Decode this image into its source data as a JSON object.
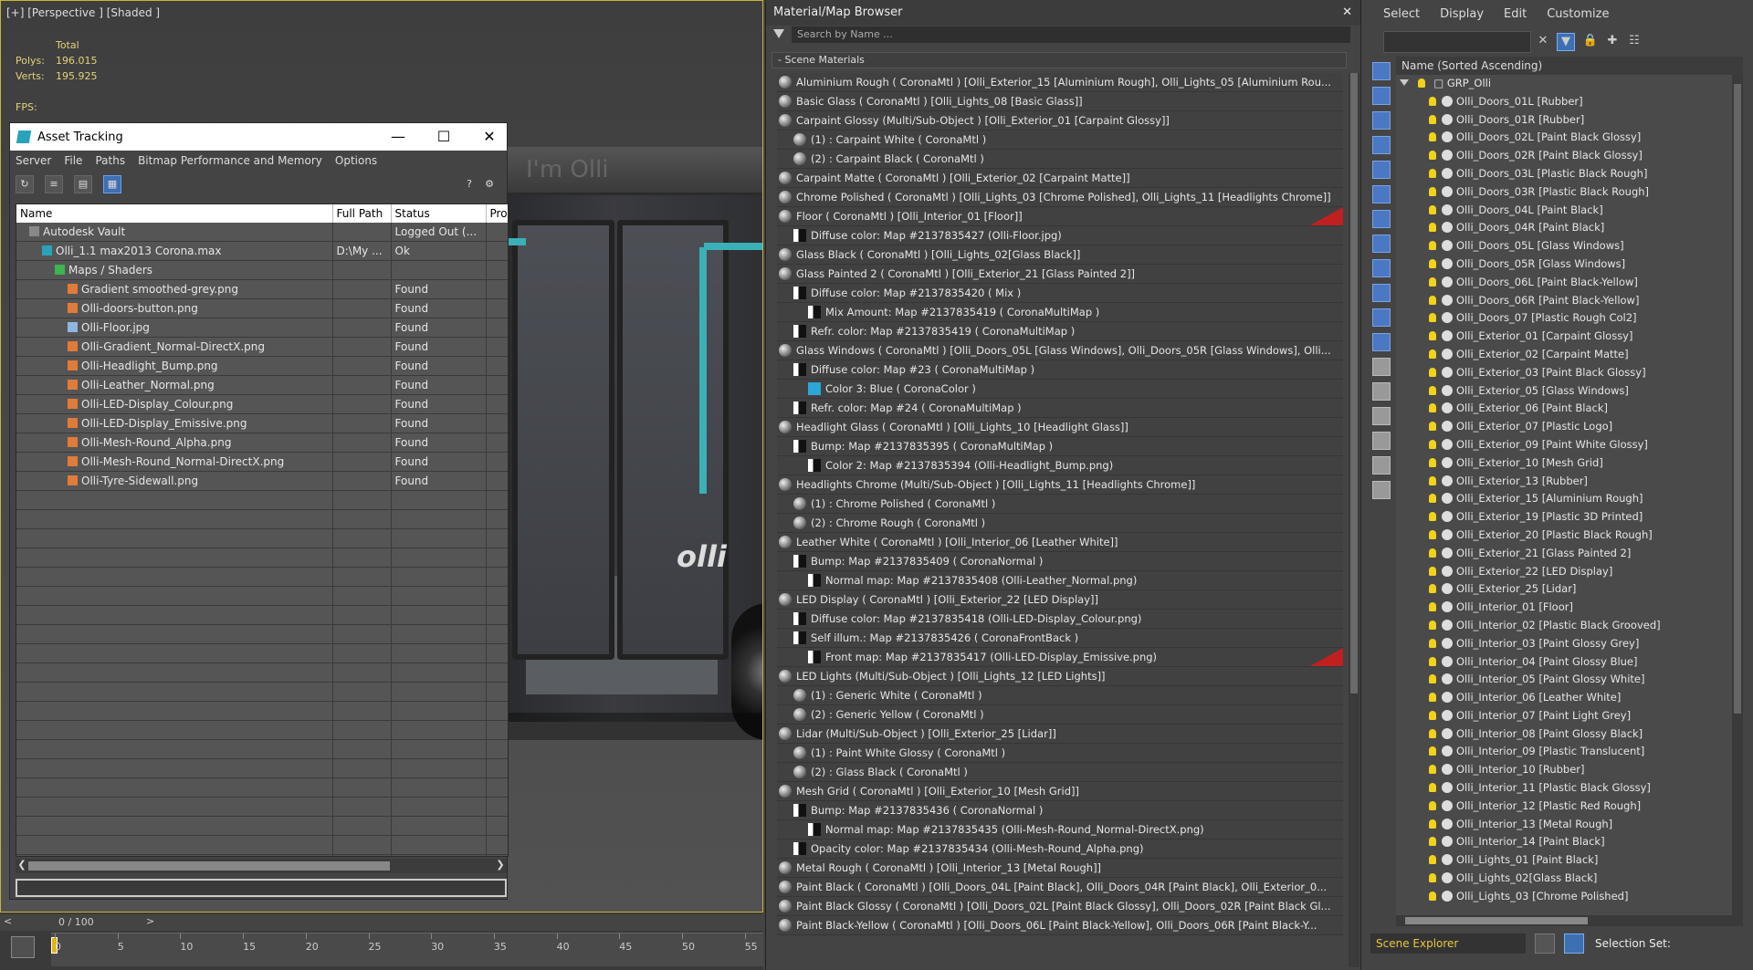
{
  "viewport": {
    "label": "[+] [Perspective ] [Shaded ]",
    "stats": {
      "total_label": "Total",
      "polys_label": "Polys:",
      "polys": "196.015",
      "verts_label": "Verts:",
      "verts": "195.925",
      "fps_label": "FPS:"
    },
    "bus_sign": "I'm Olli",
    "bus_logo": "olli"
  },
  "asset_tracking": {
    "title": "Asset Tracking",
    "menu": [
      "Server",
      "File",
      "Paths",
      "Bitmap Performance and Memory",
      "Options"
    ],
    "columns": [
      "Name",
      "Full Path",
      "Status",
      "Pro"
    ],
    "rows": [
      {
        "indent": 0,
        "icon": "vault-icon",
        "name": "Autodesk Vault",
        "path": "",
        "status": "Logged Out (..."
      },
      {
        "indent": 1,
        "icon": "max-file-icon",
        "name": "Olli_1.1 max2013 Corona.max",
        "path": "D:\\My ...",
        "status": "Ok"
      },
      {
        "indent": 2,
        "icon": "maps-folder-icon",
        "name": "Maps / Shaders",
        "path": "",
        "status": ""
      },
      {
        "indent": 3,
        "icon": "png-icon",
        "name": "Gradient smoothed-grey.png",
        "path": "",
        "status": "Found"
      },
      {
        "indent": 3,
        "icon": "png-icon",
        "name": "Olli-doors-button.png",
        "path": "",
        "status": "Found"
      },
      {
        "indent": 3,
        "icon": "jpg-icon",
        "name": "Olli-Floor.jpg",
        "path": "",
        "status": "Found"
      },
      {
        "indent": 3,
        "icon": "png-icon",
        "name": "Olli-Gradient_Normal-DirectX.png",
        "path": "",
        "status": "Found"
      },
      {
        "indent": 3,
        "icon": "png-icon",
        "name": "Olli-Headlight_Bump.png",
        "path": "",
        "status": "Found"
      },
      {
        "indent": 3,
        "icon": "png-icon",
        "name": "Olli-Leather_Normal.png",
        "path": "",
        "status": "Found"
      },
      {
        "indent": 3,
        "icon": "png-icon",
        "name": "Olli-LED-Display_Colour.png",
        "path": "",
        "status": "Found"
      },
      {
        "indent": 3,
        "icon": "png-icon",
        "name": "Olli-LED-Display_Emissive.png",
        "path": "",
        "status": "Found"
      },
      {
        "indent": 3,
        "icon": "png-icon",
        "name": "Olli-Mesh-Round_Alpha.png",
        "path": "",
        "status": "Found"
      },
      {
        "indent": 3,
        "icon": "png-icon",
        "name": "Olli-Mesh-Round_Normal-DirectX.png",
        "path": "",
        "status": "Found"
      },
      {
        "indent": 3,
        "icon": "png-icon",
        "name": "Olli-Tyre-Sidewall.png",
        "path": "",
        "status": "Found"
      }
    ]
  },
  "material_browser": {
    "title": "Material/Map Browser",
    "search_placeholder": "Search by Name ...",
    "group": "- Scene Materials",
    "items": [
      {
        "lvl": 0,
        "sw": "sphere",
        "text": "Aluminium Rough  ( CoronaMtl ) [Olli_Exterior_15 [Aluminium Rough], Olli_Lights_05 [Aluminium Rou..."
      },
      {
        "lvl": 0,
        "sw": "sphere",
        "text": "Basic Glass  ( CoronaMtl ) [Olli_Lights_08 [Basic Glass]]"
      },
      {
        "lvl": 0,
        "sw": "sphere",
        "text": "Carpaint Glossy  (Multi/Sub-Object ) [Olli_Exterior_01 [Carpaint Glossy]]"
      },
      {
        "lvl": 1,
        "sw": "sphere",
        "text": "(1) : Carpaint White  ( CoronaMtl )"
      },
      {
        "lvl": 1,
        "sw": "sphere",
        "text": "(2) : Carpaint Black  ( CoronaMtl )"
      },
      {
        "lvl": 0,
        "sw": "sphere",
        "text": "Carpaint Matte  ( CoronaMtl ) [Olli_Exterior_02 [Carpaint Matte]]"
      },
      {
        "lvl": 0,
        "sw": "sphere",
        "text": "Chrome Polished  ( CoronaMtl ) [Olli_Lights_03 [Chrome Polished], Olli_Lights_11 [Headlights Chrome]]"
      },
      {
        "lvl": 0,
        "sw": "sphere",
        "text": "Floor  ( CoronaMtl ) [Olli_Interior_01 [Floor]]",
        "flag": true
      },
      {
        "lvl": 1,
        "sw": "square",
        "text": "Diffuse color: Map #2137835427 (Olli-Floor.jpg)"
      },
      {
        "lvl": 0,
        "sw": "sphere",
        "text": "Glass Black  ( CoronaMtl ) [Olli_Lights_02[Glass Black]]"
      },
      {
        "lvl": 0,
        "sw": "sphere",
        "text": "Glass Painted 2  ( CoronaMtl ) [Olli_Exterior_21 [Glass Painted 2]]"
      },
      {
        "lvl": 1,
        "sw": "square",
        "text": "Diffuse color: Map #2137835420  ( Mix )"
      },
      {
        "lvl": 2,
        "sw": "square",
        "text": "Mix Amount: Map #2137835419  ( CoronaMultiMap )"
      },
      {
        "lvl": 1,
        "sw": "square",
        "text": "Refr. color: Map #2137835419  ( CoronaMultiMap )"
      },
      {
        "lvl": 0,
        "sw": "sphere",
        "text": "Glass Windows  ( CoronaMtl ) [Olli_Doors_05L [Glass Windows], Olli_Doors_05R [Glass Windows], Olli..."
      },
      {
        "lvl": 1,
        "sw": "square",
        "text": "Diffuse color: Map #23  ( CoronaMultiMap )"
      },
      {
        "lvl": 2,
        "sw": "square",
        "text": "Color 3: Blue  ( CoronaColor )"
      },
      {
        "lvl": 1,
        "sw": "square",
        "text": "Refr. color: Map #24  ( CoronaMultiMap )"
      },
      {
        "lvl": 0,
        "sw": "sphere",
        "text": "Headlight Glass  ( CoronaMtl ) [Olli_Lights_10 [Headlight Glass]]"
      },
      {
        "lvl": 1,
        "sw": "square",
        "text": "Bump: Map #2137835395  ( CoronaMultiMap )"
      },
      {
        "lvl": 2,
        "sw": "square",
        "text": "Color 2: Map #2137835394 (Olli-Headlight_Bump.png)"
      },
      {
        "lvl": 0,
        "sw": "sphere",
        "text": "Headlights Chrome  (Multi/Sub-Object ) [Olli_Lights_11 [Headlights Chrome]]"
      },
      {
        "lvl": 1,
        "sw": "sphere",
        "text": "(1) : Chrome Polished  ( CoronaMtl )"
      },
      {
        "lvl": 1,
        "sw": "sphere",
        "text": "(2) : Chrome Rough  ( CoronaMtl )"
      },
      {
        "lvl": 0,
        "sw": "sphere",
        "text": "Leather White  ( CoronaMtl ) [Olli_Interior_06 [Leather White]]"
      },
      {
        "lvl": 1,
        "sw": "square",
        "text": "Bump: Map #2137835409  ( CoronaNormal )"
      },
      {
        "lvl": 2,
        "sw": "square",
        "text": "Normal map: Map #2137835408 (Olli-Leather_Normal.png)"
      },
      {
        "lvl": 0,
        "sw": "sphere",
        "text": "LED Display  ( CoronaMtl ) [Olli_Exterior_22 [LED Display]]"
      },
      {
        "lvl": 1,
        "sw": "square",
        "text": "Diffuse color: Map #2137835418 (Olli-LED-Display_Colour.png)"
      },
      {
        "lvl": 1,
        "sw": "square",
        "text": "Self illum.: Map #2137835426  ( CoronaFrontBack )"
      },
      {
        "lvl": 2,
        "sw": "square",
        "text": "Front map: Map #2137835417 (Olli-LED-Display_Emissive.png)",
        "flag": true
      },
      {
        "lvl": 0,
        "sw": "sphere",
        "text": "LED Lights  (Multi/Sub-Object ) [Olli_Lights_12 [LED Lights]]"
      },
      {
        "lvl": 1,
        "sw": "sphere",
        "text": "(1) : Generic White  ( CoronaMtl )"
      },
      {
        "lvl": 1,
        "sw": "sphere",
        "text": "(2) : Generic Yellow  ( CoronaMtl )"
      },
      {
        "lvl": 0,
        "sw": "sphere",
        "text": "Lidar  (Multi/Sub-Object ) [Olli_Exterior_25 [Lidar]]"
      },
      {
        "lvl": 1,
        "sw": "sphere",
        "text": "(1) : Paint White Glossy  ( CoronaMtl )"
      },
      {
        "lvl": 1,
        "sw": "sphere",
        "text": "(2) : Glass Black  ( CoronaMtl )"
      },
      {
        "lvl": 0,
        "sw": "sphere",
        "text": "Mesh Grid  ( CoronaMtl ) [Olli_Exterior_10 [Mesh Grid]]"
      },
      {
        "lvl": 1,
        "sw": "square",
        "text": "Bump: Map #2137835436  ( CoronaNormal )"
      },
      {
        "lvl": 2,
        "sw": "square",
        "text": "Normal map: Map #2137835435 (Olli-Mesh-Round_Normal-DirectX.png)"
      },
      {
        "lvl": 1,
        "sw": "square",
        "text": "Opacity color: Map #2137835434 (Olli-Mesh-Round_Alpha.png)"
      },
      {
        "lvl": 0,
        "sw": "sphere",
        "text": "Metal Rough  ( CoronaMtl ) [Olli_Interior_13 [Metal Rough]]"
      },
      {
        "lvl": 0,
        "sw": "sphere",
        "text": "Paint Black  ( CoronaMtl ) [Olli_Doors_04L [Paint Black], Olli_Doors_04R [Paint Black], Olli_Exterior_0..."
      },
      {
        "lvl": 0,
        "sw": "sphere",
        "text": "Paint Black Glossy  ( CoronaMtl ) [Olli_Doors_02L [Paint Black Glossy], Olli_Doors_02R [Paint Black Gl..."
      },
      {
        "lvl": 0,
        "sw": "sphere",
        "text": "Paint Black-Yellow  ( CoronaMtl ) [Olli_Doors_06L [Paint Black-Yellow], Olli_Doors_06R [Paint Black-Y..."
      }
    ]
  },
  "right_panel": {
    "menu": [
      "Select",
      "Display",
      "Edit",
      "Customize"
    ],
    "tree_header": "Name (Sorted Ascending)",
    "root": "GRP_Olli",
    "objects": [
      "Olli_Doors_01L [Rubber]",
      "Olli_Doors_01R [Rubber]",
      "Olli_Doors_02L [Paint Black Glossy]",
      "Olli_Doors_02R [Paint Black Glossy]",
      "Olli_Doors_03L [Plastic Black Rough]",
      "Olli_Doors_03R [Plastic Black Rough]",
      "Olli_Doors_04L [Paint Black]",
      "Olli_Doors_04R [Paint Black]",
      "Olli_Doors_05L [Glass Windows]",
      "Olli_Doors_05R [Glass Windows]",
      "Olli_Doors_06L [Paint Black-Yellow]",
      "Olli_Doors_06R [Paint Black-Yellow]",
      "Olli_Doors_07 [Plastic Rough Col2]",
      "Olli_Exterior_01 [Carpaint Glossy]",
      "Olli_Exterior_02 [Carpaint Matte]",
      "Olli_Exterior_03 [Paint Black Glossy]",
      "Olli_Exterior_05 [Glass Windows]",
      "Olli_Exterior_06 [Paint Black]",
      "Olli_Exterior_07 [Plastic Logo]",
      "Olli_Exterior_09 [Paint White Glossy]",
      "Olli_Exterior_10 [Mesh Grid]",
      "Olli_Exterior_13 [Rubber]",
      "Olli_Exterior_15 [Aluminium Rough]",
      "Olli_Exterior_19 [Plastic 3D Printed]",
      "Olli_Exterior_20 [Plastic Black Rough]",
      "Olli_Exterior_21 [Glass Painted 2]",
      "Olli_Exterior_22 [LED Display]",
      "Olli_Exterior_25 [Lidar]",
      "Olli_Interior_01 [Floor]",
      "Olli_Interior_02 [Plastic Black Grooved]",
      "Olli_Interior_03 [Paint Glossy Grey]",
      "Olli_Interior_04 [Paint Glossy Blue]",
      "Olli_Interior_05 [Paint Glossy White]",
      "Olli_Interior_06 [Leather White]",
      "Olli_Interior_07 [Paint Light Grey]",
      "Olli_Interior_08 [Paint Glossy Black]",
      "Olli_Interior_09 [Plastic Translucent]",
      "Olli_Interior_10 [Rubber]",
      "Olli_Interior_11 [Plastic Black Glossy]",
      "Olli_Interior_12 [Plastic Red Rough]",
      "Olli_Interior_13 [Metal Rough]",
      "Olli_Interior_14 [Paint Black]",
      "Olli_Lights_01 [Paint Black]",
      "Olli_Lights_02[Glass Black]",
      "Olli_Lights_03 [Chrome Polished]"
    ],
    "explorer_name": "Scene Explorer",
    "selection_set_label": "Selection Set:"
  },
  "timeline": {
    "frame_label": "0 / 100",
    "ticks": [
      "0",
      "5",
      "10",
      "15",
      "20",
      "25",
      "30",
      "35",
      "40",
      "45",
      "50",
      "55"
    ]
  }
}
